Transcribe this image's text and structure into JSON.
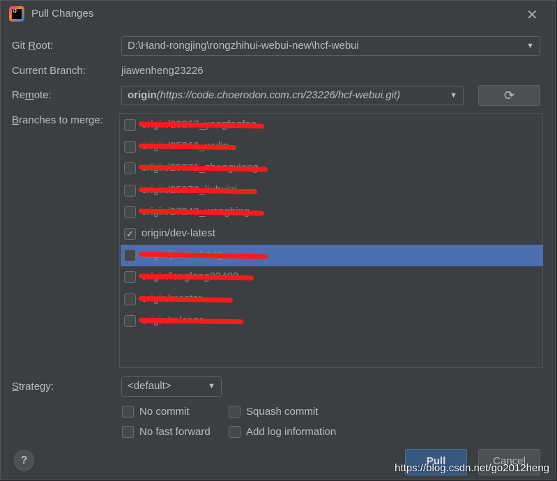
{
  "window": {
    "title": "Pull Changes",
    "app_icon": "intellij-icon",
    "close_icon": "close-icon"
  },
  "git_root": {
    "label": "Git Root:",
    "value": "D:\\Hand-rongjing\\rongzhihui-webui-new\\hcf-webui"
  },
  "current_branch": {
    "label": "Current Branch:",
    "value": "jiawenheng23226"
  },
  "remote": {
    "label": "Remote:",
    "name": "origin",
    "url": "(https://code.choerodon.com.cn/23226/hcf-webui.git)",
    "refresh_icon": "refresh-icon"
  },
  "branches": {
    "label": "Branches to merge:",
    "items": [
      {
        "label": "origin/23267_yangfanfan",
        "checked": false,
        "selected": false,
        "redacted": true
      },
      {
        "label": "origin/25366_wulin",
        "checked": false,
        "selected": false,
        "redacted": true
      },
      {
        "label": "origin/25371_zhengxiang",
        "checked": false,
        "selected": false,
        "redacted": true
      },
      {
        "label": "origin/25372_liuhuizi",
        "checked": false,
        "selected": false,
        "redacted": true
      },
      {
        "label": "origin/27243_wangbing",
        "checked": false,
        "selected": false,
        "redacted": true
      },
      {
        "label": "origin/dev-latest",
        "checked": true,
        "selected": false,
        "redacted": false
      },
      {
        "label": "origin/jiawenheng",
        "checked": false,
        "selected": true,
        "redacted": true
      },
      {
        "label": "origin/longlong23409",
        "checked": false,
        "selected": false,
        "redacted": true
      },
      {
        "label": "origin/master",
        "checked": false,
        "selected": false,
        "redacted": true
      },
      {
        "label": "origin/release",
        "checked": false,
        "selected": false,
        "redacted": true
      }
    ]
  },
  "strategy": {
    "label": "Strategy:",
    "value": "<default>"
  },
  "options": {
    "no_commit": "No commit",
    "squash_commit": "Squash commit",
    "no_fast_forward": "No fast forward",
    "add_log": "Add log information"
  },
  "buttons": {
    "help": "?",
    "pull": "Pull",
    "cancel": "Cancel"
  },
  "watermark": "https://blog.csdn.net/go2012heng",
  "colors": {
    "background": "#3c3f41",
    "selection": "#4b6eaf",
    "pull_button": "#365880",
    "redaction": "#ff1a1a"
  }
}
